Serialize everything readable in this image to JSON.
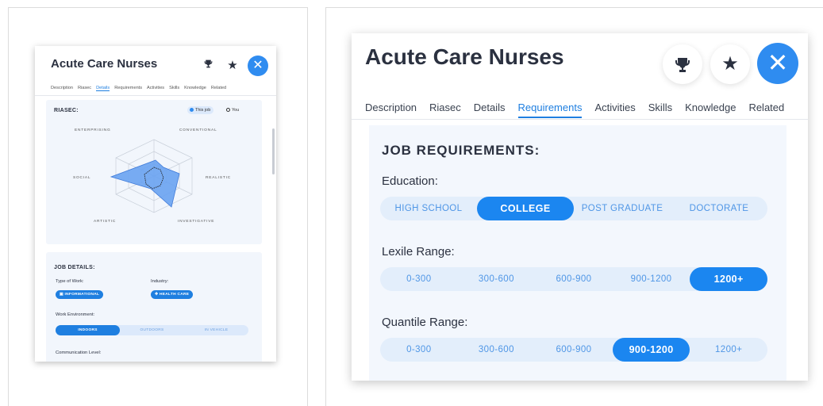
{
  "colors": {
    "accent": "#1f7fe0",
    "close": "#2f8cf0",
    "panel": "#f3f7fd",
    "segment_bg": "#e3eefb"
  },
  "small_card": {
    "title": "Acute Care Nurses",
    "icons": [
      "trophy-icon",
      "star-icon",
      "close-icon"
    ],
    "tabs": [
      "Description",
      "Riasec",
      "Details",
      "Requirements",
      "Activities",
      "Skills",
      "Knowledge",
      "Related"
    ],
    "active_tab": "Details",
    "riasec": {
      "heading": "RIASEC:",
      "toggle_this_job": "This job",
      "toggle_you": "You",
      "axes": [
        "ENTERPRISING",
        "CONVENTIONAL",
        "REALISTIC",
        "INVESTIGATIVE",
        "ARTISTIC",
        "SOCIAL"
      ]
    },
    "job_details": {
      "heading": "JOB DETAILS:",
      "type_of_work_label": "Type of Work:",
      "type_of_work_value": "INFORMATIONAL",
      "industry_label": "Industry:",
      "industry_value": "HEALTH CARE",
      "work_env_label": "Work Environment:",
      "work_env_options": [
        "INDOORS",
        "OUTDOORS",
        "IN VEHICLE"
      ],
      "work_env_selected": "INDOORS",
      "communication_label": "Communication Level:"
    }
  },
  "large_card": {
    "title": "Acute Care Nurses",
    "icons": [
      "trophy-icon",
      "star-icon",
      "close-icon"
    ],
    "tabs": [
      "Description",
      "Riasec",
      "Details",
      "Requirements",
      "Activities",
      "Skills",
      "Knowledge",
      "Related"
    ],
    "active_tab": "Requirements",
    "requirements": {
      "heading": "JOB REQUIREMENTS:",
      "education": {
        "label": "Education:",
        "options": [
          "HIGH SCHOOL",
          "COLLEGE",
          "POST GRADUATE",
          "DOCTORATE"
        ],
        "selected": "COLLEGE"
      },
      "lexile": {
        "label": "Lexile Range:",
        "options": [
          "0-300",
          "300-600",
          "600-900",
          "900-1200",
          "1200+"
        ],
        "selected": "1200+"
      },
      "quantile": {
        "label": "Quantile Range:",
        "options": [
          "0-300",
          "300-600",
          "600-900",
          "900-1200",
          "1200+"
        ],
        "selected": "900-1200"
      }
    }
  }
}
